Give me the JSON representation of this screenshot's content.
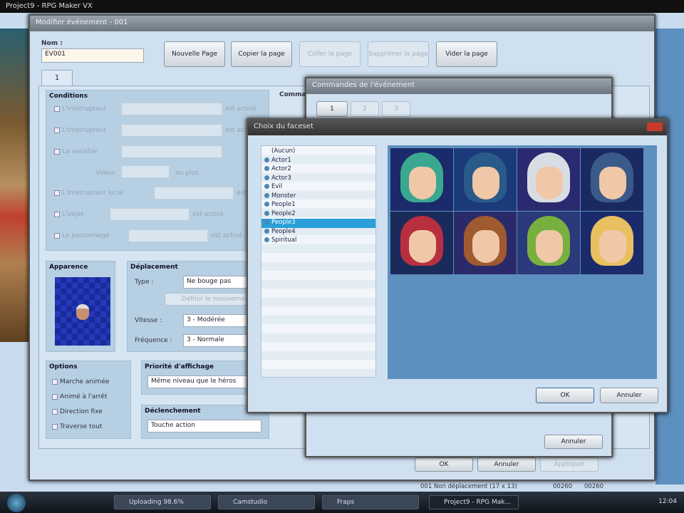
{
  "app_title": "Project9 - RPG Maker VX",
  "event_dialog": {
    "title": "Modifier événement - 001",
    "name_label": "Nom :",
    "name_value": "EV001",
    "buttons": [
      "Nouvelle Page",
      "Copier la page",
      "Coller la page",
      "Supprimer la page",
      "Vider la page"
    ],
    "tab": "1",
    "conditions": {
      "title": "Conditions",
      "rows": [
        "L'interrupteur",
        "L'interrupteur",
        "La variable",
        "L'interrupteur local",
        "L'objet",
        "Le personnage"
      ],
      "value_label": "Valeur",
      "or_more": "ou plus",
      "is_on": "est activé"
    },
    "commands_label": "Commandes",
    "appearance": {
      "title": "Apparence"
    },
    "movement": {
      "title": "Déplacement",
      "type_label": "Type :",
      "type_value": "Ne bouge pas",
      "route_button": "Définir le mouvement",
      "speed_label": "Vitesse :",
      "speed_value": "3 - Modérée",
      "freq_label": "Fréquence :",
      "freq_value": "3 - Normale"
    },
    "options": {
      "title": "Options",
      "items": [
        "Marche animée",
        "Animé à l'arrêt",
        "Direction fixe",
        "Traverse tout"
      ]
    },
    "priority": {
      "title": "Priorité d'affichage",
      "value": "Même niveau que le héros"
    },
    "trigger": {
      "title": "Déclenchement",
      "value": "Touche action"
    },
    "footer": [
      "OK",
      "Annuler",
      "Appliquer"
    ]
  },
  "commands_dialog": {
    "title": "Commandes de l'événement",
    "tabs": [
      "1",
      "2",
      "3"
    ],
    "cancel": "Annuler"
  },
  "faceset_dialog": {
    "title": "Choix du faceset",
    "items": [
      "(Aucun)",
      "Actor1",
      "Actor2",
      "Actor3",
      "Evil",
      "Monster",
      "People1",
      "People2",
      "People3",
      "People4",
      "Spiritual"
    ],
    "selected_index": 8,
    "ok": "OK",
    "cancel": "Annuler"
  },
  "faces": [
    {
      "hair": "#3aa890",
      "bg": "#1a2a6a"
    },
    {
      "hair": "#2a5a8a",
      "bg": "#1a3a7a"
    },
    {
      "hair": "#d8dde4",
      "bg": "#2a2a70"
    },
    {
      "hair": "#3a5a8a",
      "bg": "#1a2a60"
    },
    {
      "hair": "#b83040",
      "bg": "#1a2a5a"
    },
    {
      "hair": "#a05a30",
      "bg": "#2a2a6a"
    },
    {
      "hair": "#78b040",
      "bg": "#2a3a7a"
    },
    {
      "hair": "#e8c060",
      "bg": "#1a2a6a"
    }
  ],
  "status_bar": [
    "001 Non déplacement (17 x 13)",
    "00260",
    "00260"
  ],
  "taskbar": {
    "items": [
      "Uploading 98.6%",
      "Camstudio",
      "Fraps",
      "Project9 - RPG Mak..."
    ],
    "clock": "12:04"
  }
}
